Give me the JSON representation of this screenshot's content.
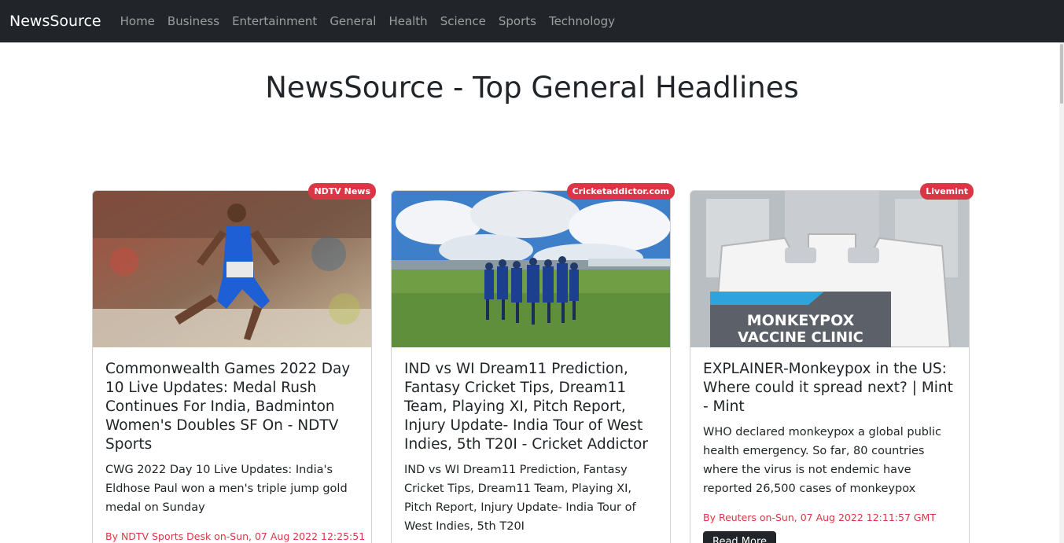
{
  "nav": {
    "brand": "NewsSource",
    "links": [
      "Home",
      "Business",
      "Entertainment",
      "General",
      "Health",
      "Science",
      "Sports",
      "Technology"
    ]
  },
  "page_title": "NewsSource - Top General Headlines",
  "cards": [
    {
      "source": "NDTV News",
      "title": "Commonwealth Games 2022 Day 10 Live Updates: Medal Rush Continues For India, Badminton Women's Doubles SF On - NDTV Sports",
      "description": "CWG 2022 Day 10 Live Updates: India's Eldhose Paul won a men's triple jump gold medal on Sunday",
      "meta": "By NDTV Sports Desk on-Sun, 07 Aug 2022 12:25:51",
      "image_alt": "Athlete in India jersey mid-jump"
    },
    {
      "source": "Cricketaddictor.com",
      "title": "IND vs WI Dream11 Prediction, Fantasy Cricket Tips, Dream11 Team, Playing XI, Pitch Report, Injury Update- India Tour of West Indies, 5th T20I - Cricket Addictor",
      "description": "IND vs WI Dream11 Prediction, Fantasy Cricket Tips, Dream11 Team, Playing XI, Pitch Report, Injury Update- India Tour of West Indies, 5th T20I",
      "meta": "",
      "image_alt": "Indian cricket team huddle on field"
    },
    {
      "source": "Livemint",
      "title": "EXPLAINER-Monkeypox in the US: Where could it spread next? | Mint - Mint",
      "description": "WHO declared monkeypox a global public health emergency. So far, 80 countries where the virus is not endemic have reported 26,500 cases of monkeypox",
      "meta": "By Reuters on-Sun, 07 Aug 2022 12:11:57 GMT",
      "image_sign_line1": "MONKEYPOX",
      "image_sign_line2": "VACCINE CLINIC",
      "image_alt": "Monkeypox vaccine clinic sign"
    }
  ],
  "read_more_label": "Read More",
  "colors": {
    "navbar": "#212529",
    "badge": "#dc3545",
    "meta": "#dc3545"
  }
}
